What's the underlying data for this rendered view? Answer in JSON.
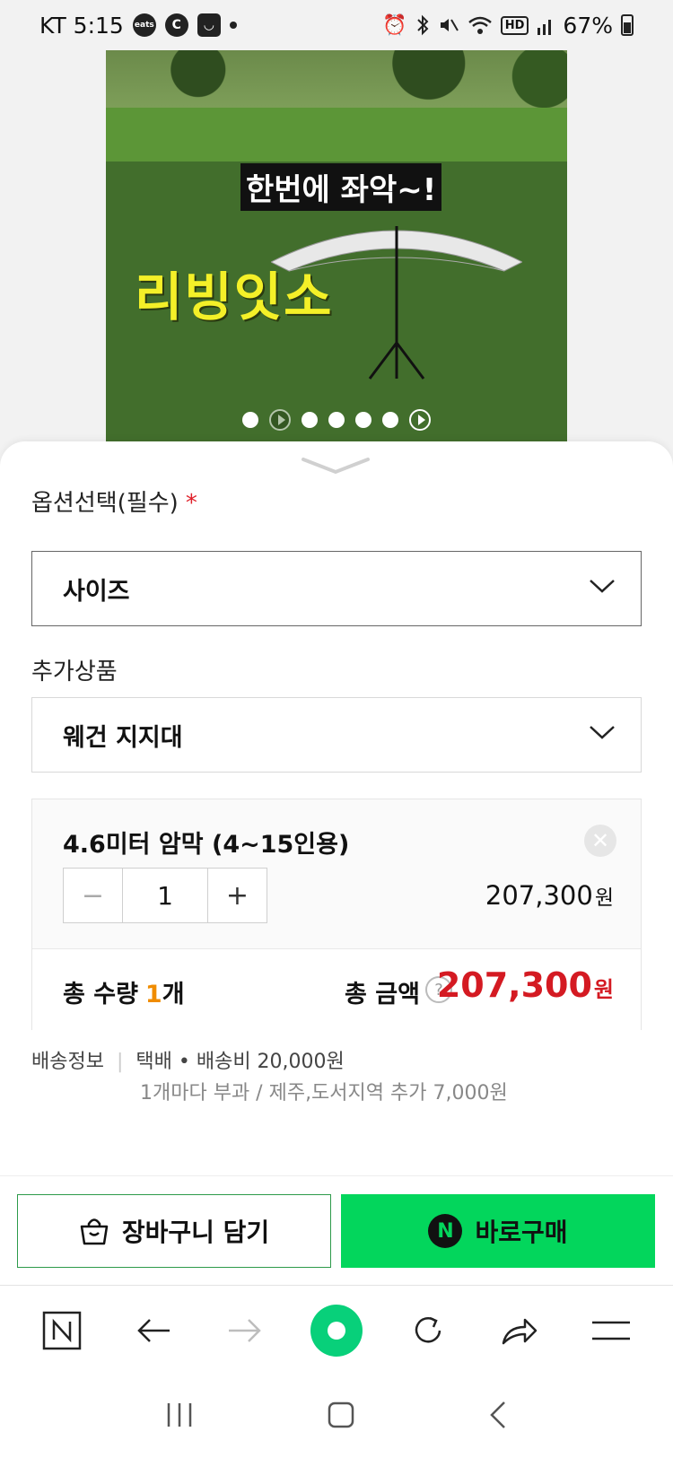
{
  "status_bar": {
    "carrier_time": "KT 5:15",
    "app_badge_1": "eats",
    "app_badge_2": "C",
    "battery": "67%",
    "network_badge": "HD"
  },
  "product_image": {
    "caption": "한번에 좌악~!",
    "title": "리빙잇소",
    "dots_count": 7
  },
  "option_section": {
    "label": "옵션선택(필수)",
    "required_mark": "*",
    "select_value": "사이즈"
  },
  "addon_section": {
    "label": "추가상품",
    "select_value": "웨건 지지대"
  },
  "selected_option": {
    "name": "4.6미터 암막 (4~15인용)",
    "remove_symbol": "✕",
    "minus_symbol": "−",
    "plus_symbol": "+",
    "quantity": "1",
    "price": "207,300",
    "price_unit": "원"
  },
  "summary": {
    "total_qty_label": "총 수량",
    "total_qty_value": "1",
    "total_qty_unit": "개",
    "total_price_label": "총 금액",
    "help_symbol": "?",
    "total_price": "207,300",
    "total_price_unit": "원"
  },
  "shipping": {
    "label": "배송정보",
    "separator": "|",
    "info": "택배 • 배송비 20,000원",
    "extra": "1개마다 부과 / 제주,도서지역 추가 7,000원"
  },
  "actions": {
    "cart_label": "장바구니 담기",
    "buy_label": "바로구매",
    "npay_letter": "N"
  },
  "colors": {
    "buy_green": "#03d65c",
    "price_red": "#d41a22",
    "qty_orange": "#f08c00",
    "home_green": "#08d07a"
  }
}
